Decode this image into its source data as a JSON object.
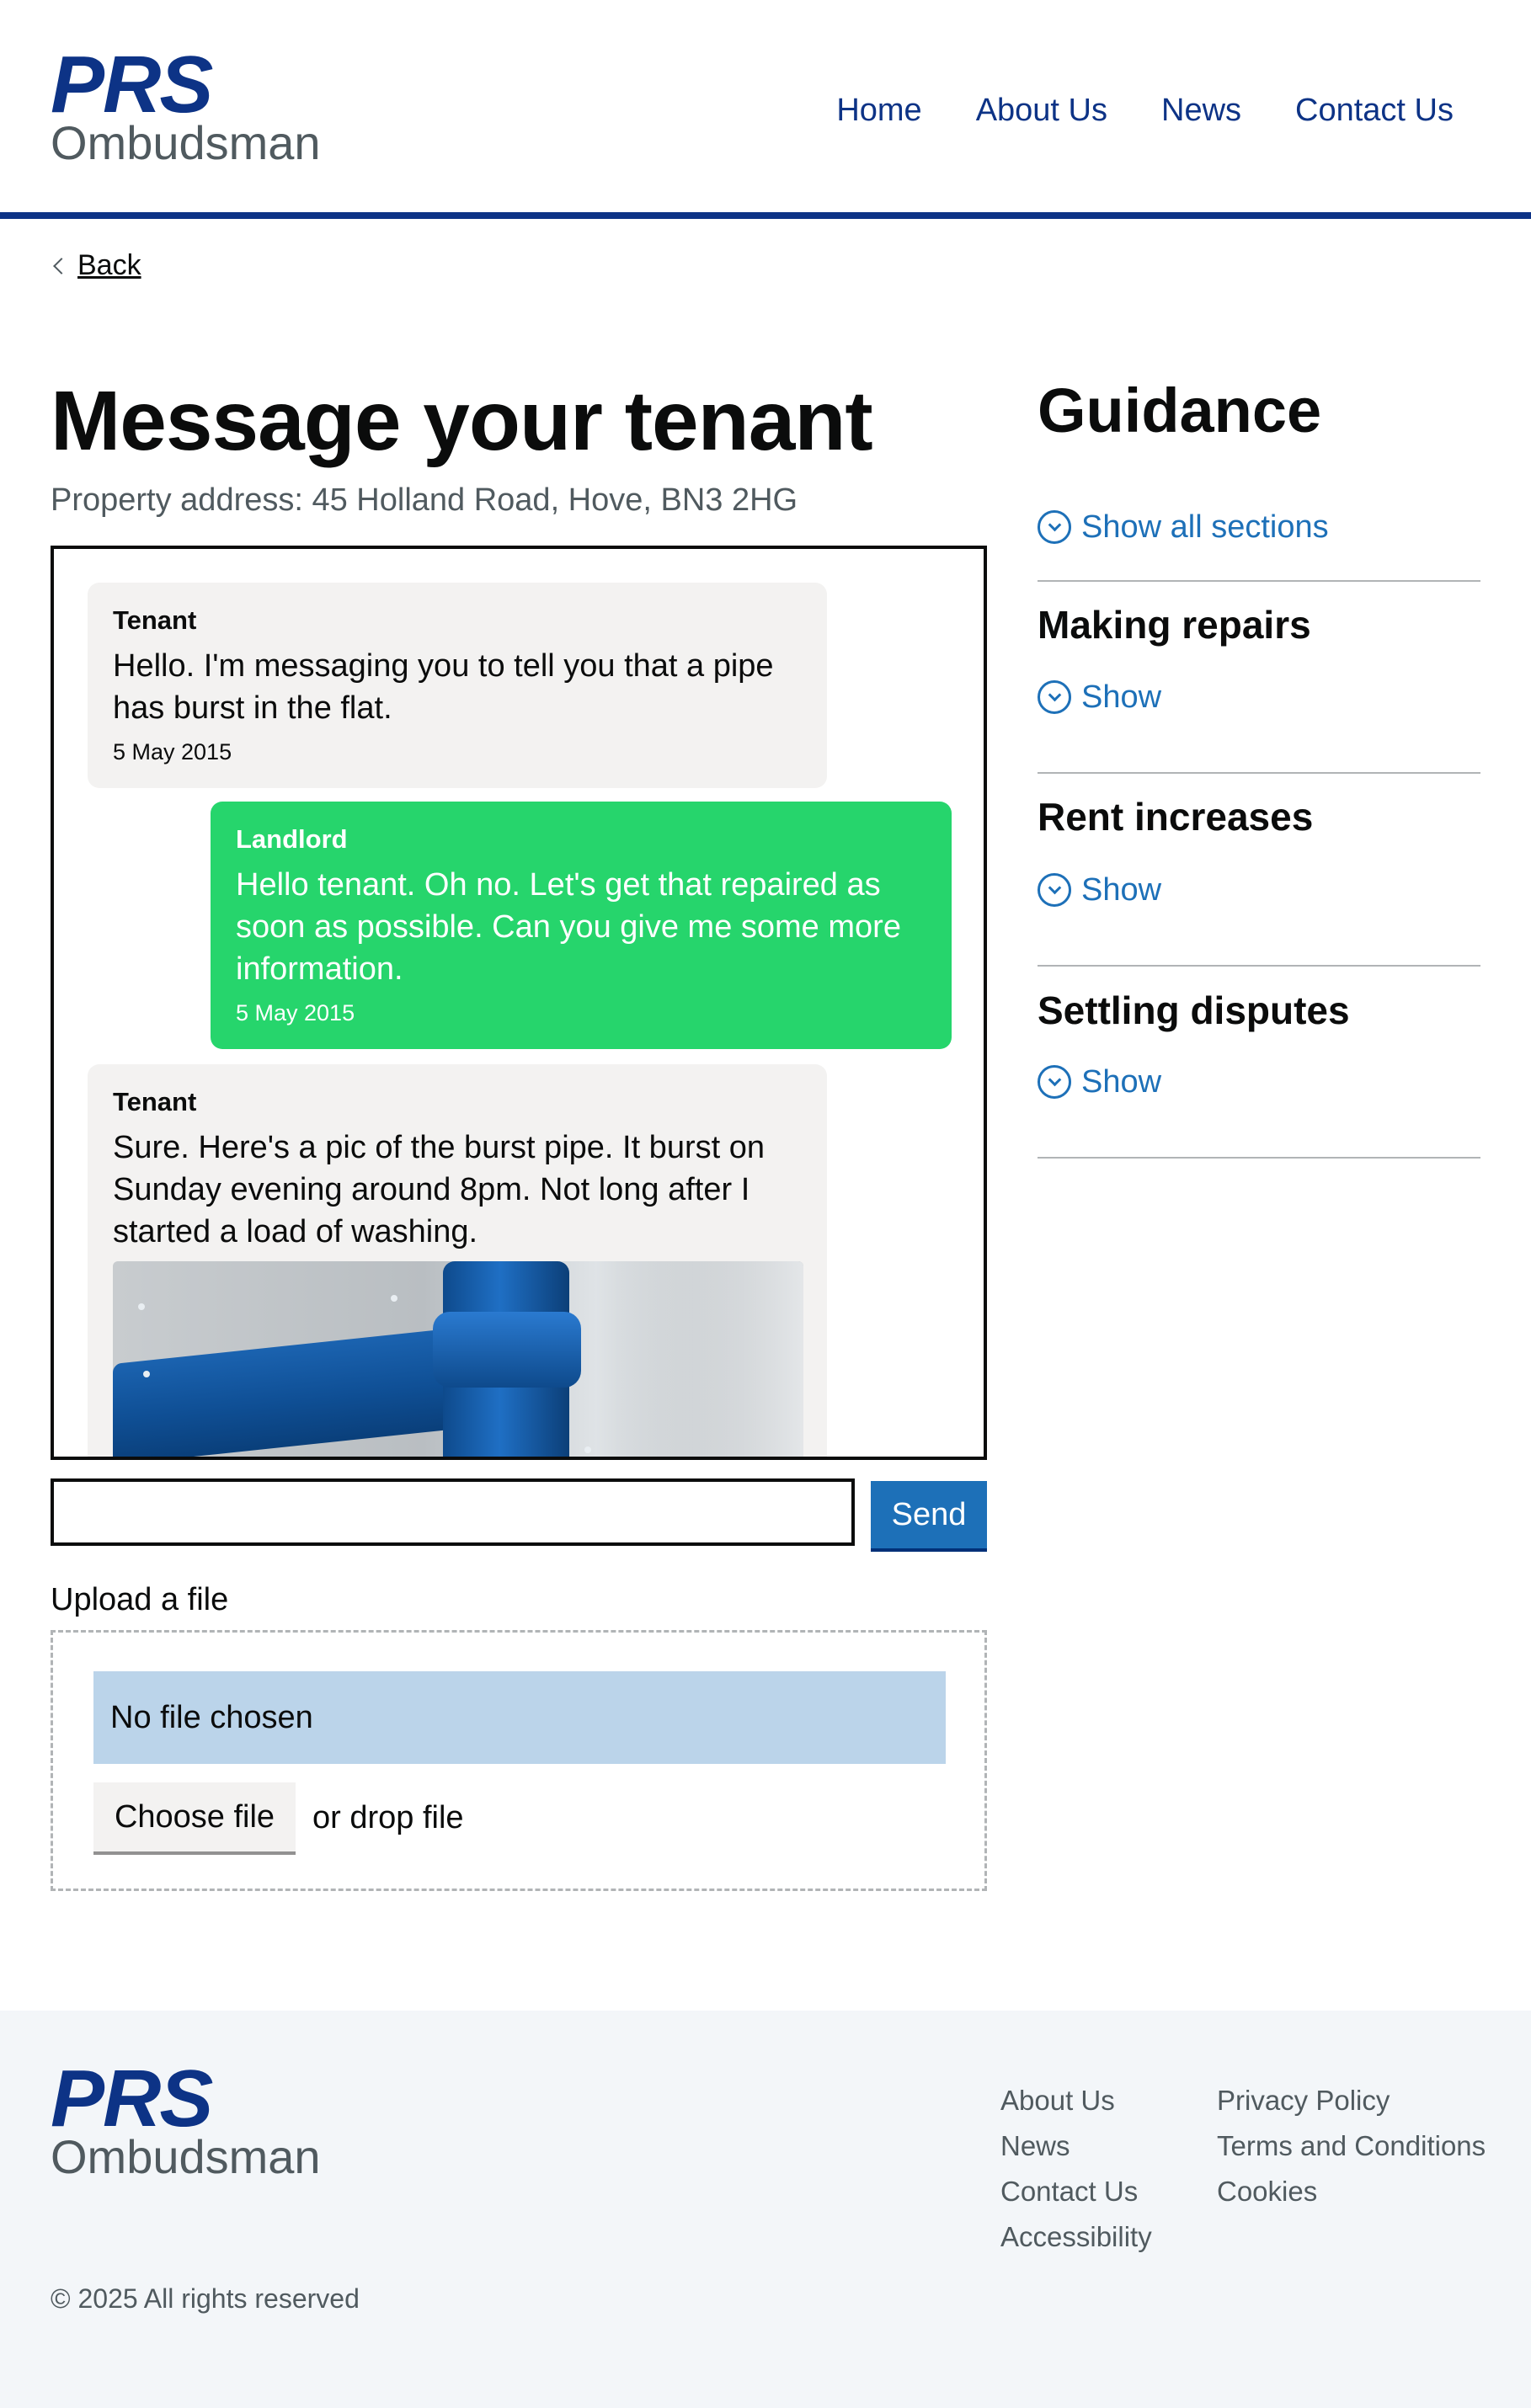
{
  "brand": {
    "prs": "PRS",
    "ombudsman": "Ombudsman"
  },
  "nav": {
    "home": "Home",
    "about": "About Us",
    "news": "News",
    "contact": "Contact Us"
  },
  "back_label": "Back",
  "page": {
    "title": "Message your tenant",
    "address": "Property address: 45 Holland Road, Hove, BN3 2HG"
  },
  "messages": [
    {
      "sender": "Tenant",
      "text": "Hello. I'm messaging you to tell you that a pipe has burst in the flat.",
      "date": "5 May 2015"
    },
    {
      "sender": "Landlord",
      "text": "Hello tenant. Oh no. Let's get that repaired as soon as possible. Can you give me some more information.",
      "date": "5 May 2015"
    },
    {
      "sender": "Tenant",
      "text": "Sure. Here's a pic of the burst pipe. It burst on Sunday evening around 8pm. Not long after I started a load of washing."
    }
  ],
  "composer": {
    "value": "",
    "send_label": "Send"
  },
  "upload": {
    "label": "Upload a file",
    "status": "No file chosen",
    "choose_label": "Choose file",
    "drop_text": "or drop file"
  },
  "guidance": {
    "title": "Guidance",
    "show_all": "Show all sections",
    "sections": [
      {
        "heading": "Making repairs",
        "toggle": "Show"
      },
      {
        "heading": "Rent increases",
        "toggle": "Show"
      },
      {
        "heading": "Settling disputes",
        "toggle": "Show"
      }
    ]
  },
  "footer": {
    "col1": [
      "About Us",
      "News",
      "Contact Us",
      "Accessibility"
    ],
    "col2": [
      "Privacy Policy",
      "Terms and Conditions",
      "Cookies"
    ],
    "copyright": "© 2025 All rights reserved"
  },
  "colors": {
    "brand_blue": "#0d3386",
    "link_blue": "#1d70b8",
    "landlord_green": "#26d56c",
    "tenant_grey": "#f3f2f1",
    "upload_status_bg": "#bbd4ea",
    "footer_bg": "#f3f6f9"
  },
  "icons": {
    "back": "chevron-left-icon",
    "expand": "chevron-down-circle-icon"
  }
}
